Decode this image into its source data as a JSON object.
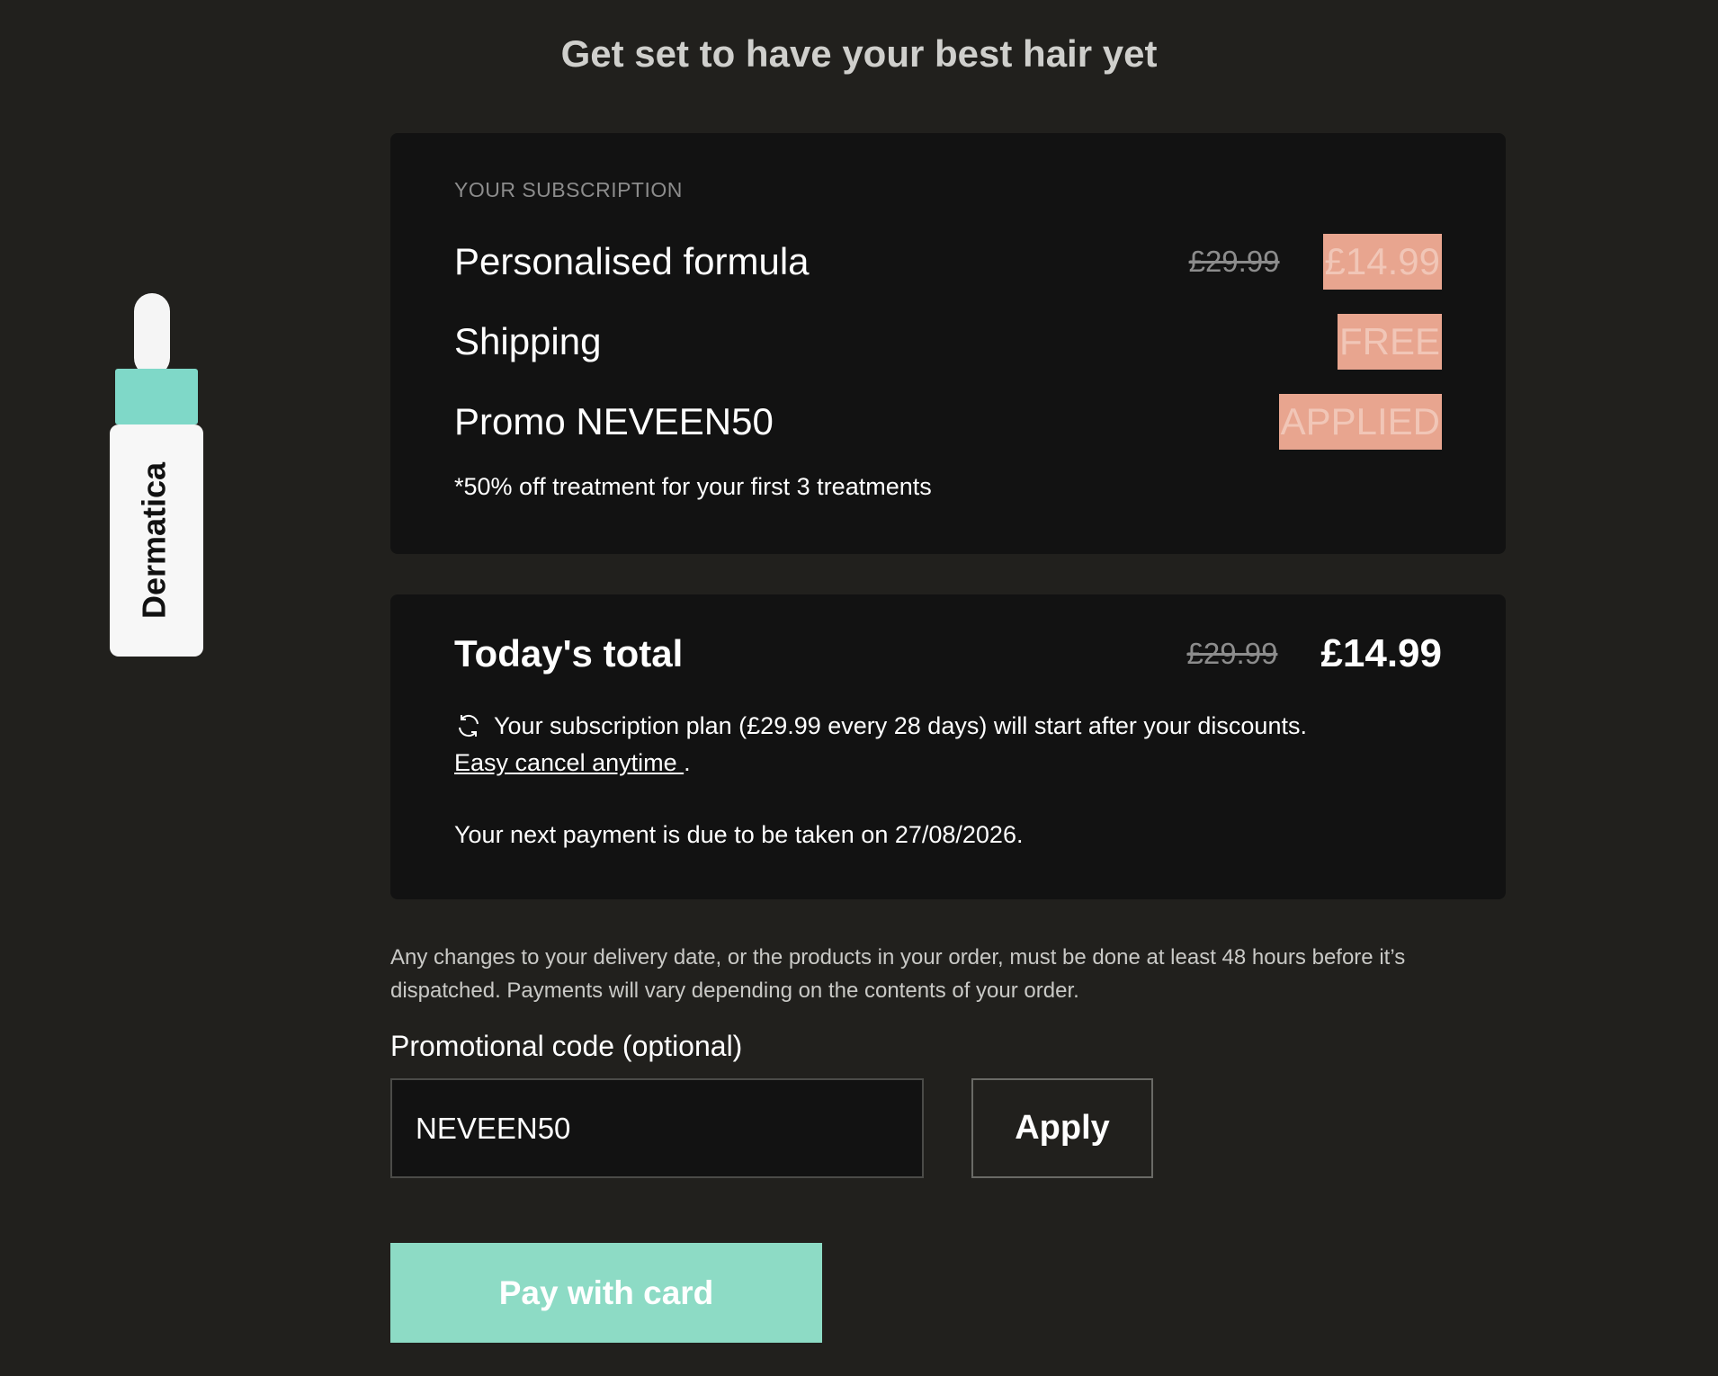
{
  "header": {
    "title": "Get set to have your best hair yet"
  },
  "product": {
    "brand": "Dermatica"
  },
  "subscription": {
    "heading": "YOUR SUBSCRIPTION",
    "items": [
      {
        "label": "Personalised formula",
        "old_price": "£29.99",
        "badge": "£14.99"
      },
      {
        "label": "Shipping",
        "badge": "FREE"
      },
      {
        "label": "Promo NEVEEN50",
        "badge": "APPLIED"
      }
    ],
    "footnote": "*50% off treatment for your first 3 treatments"
  },
  "total": {
    "label": "Today's total",
    "old_price": "£29.99",
    "price": "£14.99",
    "plan_text": "Your subscription plan (£29.99 every 28 days) will start after your discounts.",
    "cancel_link": "Easy cancel anytime ",
    "cancel_suffix": ".",
    "next_payment": "Your next payment is due to be taken on 27/08/2026."
  },
  "disclaimer": "Any changes to your delivery date, or the products in your order, must be done at least 48 hours before it’s dispatched. Payments will vary depending on the contents of your order.",
  "promo": {
    "label": "Promotional code (optional)",
    "value": "NEVEEN50",
    "apply_label": "Apply"
  },
  "pay_button_label": "Pay with card",
  "colors": {
    "background": "#21201d",
    "card": "#121212",
    "badge": "#e8a58f",
    "accent": "#8ddbc5"
  },
  "icons": {
    "refresh": "refresh-icon"
  }
}
